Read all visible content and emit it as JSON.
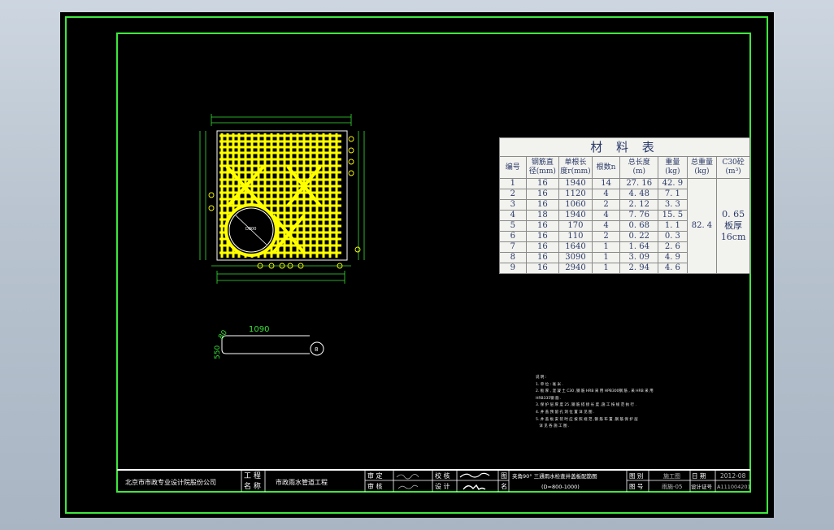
{
  "material_table": {
    "title": "材 料 表",
    "headers": {
      "no": "编号",
      "dia_1": "钢筋直",
      "dia_2": "径(mm)",
      "len_1": "单根长",
      "len_2": "度r(mm)",
      "count": "根数n",
      "total_1": "总长度",
      "total_2": "(m)",
      "wt_1": "重量",
      "wt_2": "(kg)",
      "sum_1": "总重量",
      "sum_2": "(kg)",
      "conc_1": "C30砼",
      "conc_2": "(m³)"
    },
    "rows": [
      {
        "no": "1",
        "dia": "16",
        "len": "1940",
        "n": "14",
        "total": "27. 16",
        "wt": "42. 9"
      },
      {
        "no": "2",
        "dia": "16",
        "len": "1120",
        "n": "4",
        "total": "4. 48",
        "wt": "7. 1"
      },
      {
        "no": "3",
        "dia": "16",
        "len": "1060",
        "n": "2",
        "total": "2. 12",
        "wt": "3. 3"
      },
      {
        "no": "4",
        "dia": "18",
        "len": "1940",
        "n": "4",
        "total": "7. 76",
        "wt": "15. 5"
      },
      {
        "no": "5",
        "dia": "16",
        "len": "170",
        "n": "4",
        "total": "0. 68",
        "wt": "1. 1"
      },
      {
        "no": "6",
        "dia": "16",
        "len": "110",
        "n": "2",
        "total": "0. 22",
        "wt": "0. 3"
      },
      {
        "no": "7",
        "dia": "16",
        "len": "1640",
        "n": "1",
        "total": "1. 64",
        "wt": "2. 6"
      },
      {
        "no": "8",
        "dia": "16",
        "len": "3090",
        "n": "1",
        "total": "3. 09",
        "wt": "4. 9"
      },
      {
        "no": "9",
        "dia": "16",
        "len": "2940",
        "n": "1",
        "total": "2. 94",
        "wt": "4. 6"
      }
    ],
    "total_weight": "82. 4",
    "concrete_1": "0. 65",
    "concrete_2": "板厚",
    "concrete_3": "16cm"
  },
  "rebar_detail": {
    "length": "1090",
    "hook": "80",
    "height": "550",
    "mark": "8"
  },
  "plan": {
    "pipe_label": "D800"
  },
  "notes": [
    "说 明 :",
    "1. 单 位 : 毫 米 .",
    "2. 板 厚 , 混 凝 土 C30 ,钢 筋 HRB 采 用 HPB300钢 筋 , 采 HRB 采 用",
    "HRB335钢 筋 .",
    "3. 保 护 层 厚 度 25 ,钢 筋 搭 接 长 度 ,施 工 按 规 范 执 行 .",
    "4. 井 盖 预 留 孔 洞 位 置 详 见 图 .",
    "5. 井 盖 板 安 装 时 应 按 照 规 范 ,钢 筋 布 置 ,钢 筋 保 护 层",
    "   详 见 各 施 工 图 ."
  ],
  "title_block": {
    "company": "北京市市政专业设计院股份公司",
    "project_key_1": "工 程",
    "project_key_2": "名 称",
    "project_name": "市政雨水管道工程",
    "review_1": "审 定",
    "review_2": "审 核",
    "check_1": "校 核",
    "check_2": "设 计",
    "drawing_name_key_1": "图",
    "drawing_name_key_2": "名",
    "drawing_name_1": "夹角90° 三通雨水检查井盖板配筋图",
    "drawing_name_2": "(D=800-1000)",
    "category_key": "图 别",
    "category_val": "施工图",
    "date_key": "日 期",
    "date_val": "2012-08",
    "drawing_no_key": "图 号",
    "drawing_no_val": "雨施-05",
    "design_no_key": "设计证号",
    "design_no_val": "A111004201"
  },
  "colors": {
    "frame": "#3ee83e",
    "rebar": "#ffff00",
    "dimension": "#37e037",
    "table_text": "#2a3a6a"
  }
}
